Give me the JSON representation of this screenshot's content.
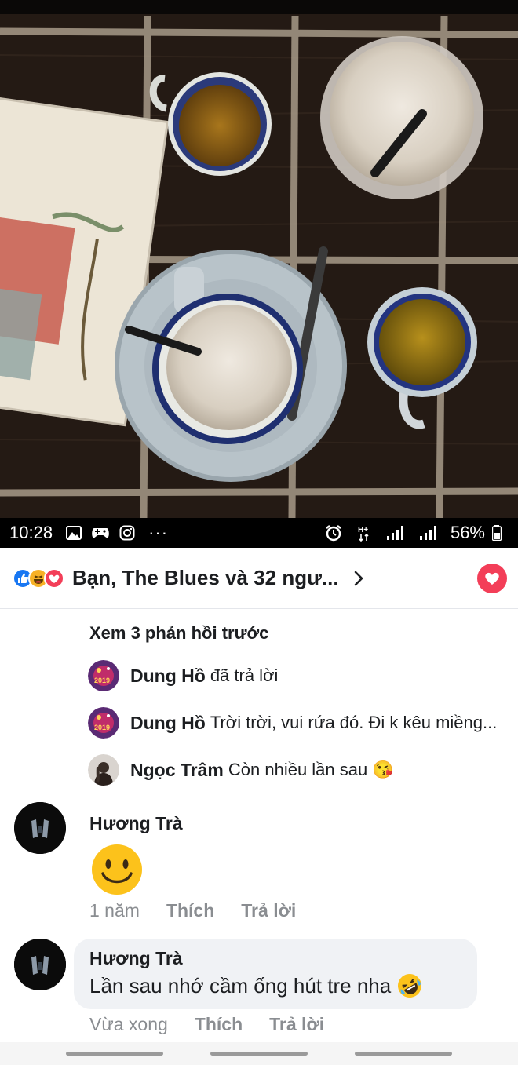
{
  "status_bar": {
    "time": "10:28",
    "battery": "56%",
    "overflow": "···",
    "icons": [
      "gallery-icon",
      "game-controller-icon",
      "instagram-icon",
      "alarm-icon",
      "signal-h-plus-icon",
      "signal-bars-icon",
      "signal-bars-2-icon",
      "battery-icon"
    ]
  },
  "reactions": {
    "summary": "Bạn, The Blues và 32 ngư...",
    "icons": [
      "like-icon",
      "haha-icon",
      "love-icon"
    ]
  },
  "view_previous": "Xem 3 phản hồi trước",
  "replies": [
    {
      "name": "Dung Hồ",
      "text": "đã trả lời"
    },
    {
      "name": "Dung Hồ",
      "text": "Trời trời, vui rứa đó. Đi k kêu miềng..."
    },
    {
      "name": "Ngọc Trâm",
      "text": "Còn nhiều lần sau 😘"
    }
  ],
  "comments": [
    {
      "name": "Hương Trà",
      "content": "smiley-emoji",
      "time": "1 năm",
      "like": "Thích",
      "reply": "Trả lời"
    },
    {
      "name": "Hương Trà",
      "text": "Lần sau nhớ cầm ống hút tre nha",
      "emoji": "rolling-on-floor-laughing-emoji",
      "time": "Vừa xong",
      "like": "Thích",
      "reply": "Trả lời"
    }
  ],
  "colors": {
    "like": "#1877f2",
    "haha": "#f7b125",
    "love": "#f33e58",
    "text": "#1c1e21",
    "meta": "#8a8d91",
    "bubble": "#f0f2f5"
  }
}
